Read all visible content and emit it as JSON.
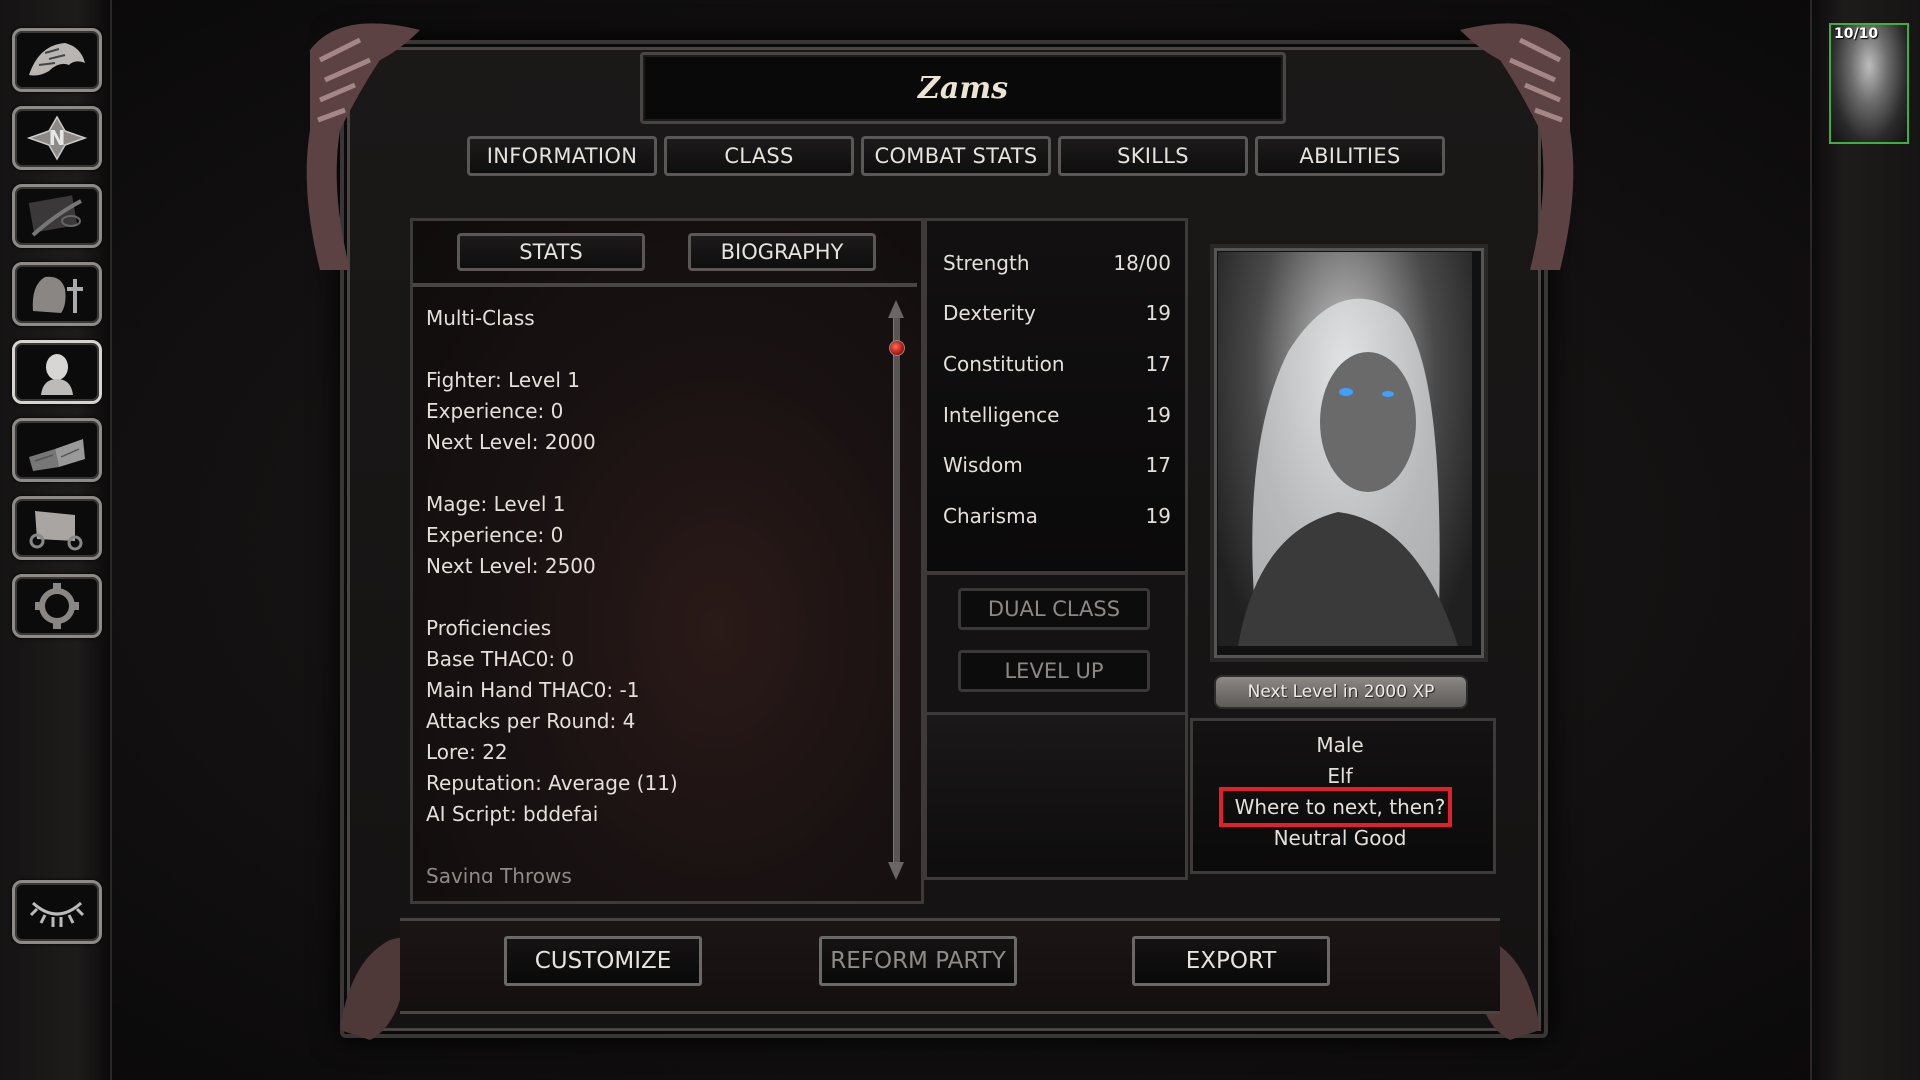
{
  "sidebar": {
    "items": [
      {
        "name": "return-to-game",
        "icon": "dragon-head-icon"
      },
      {
        "name": "map",
        "icon": "compass-icon"
      },
      {
        "name": "journal",
        "icon": "quill-icon"
      },
      {
        "name": "inventory",
        "icon": "armor-sword-icon"
      },
      {
        "name": "character-record",
        "icon": "head-bust-icon",
        "active": true
      },
      {
        "name": "mage-spellbook",
        "icon": "book-icon"
      },
      {
        "name": "priest-scroll",
        "icon": "scroll-icon"
      },
      {
        "name": "options",
        "icon": "gear-icon"
      }
    ],
    "rest_button_icon": "closed-eye-icon"
  },
  "party": {
    "portraits": [
      {
        "hp": "10/10",
        "selected": true
      }
    ]
  },
  "character": {
    "name": "Zams"
  },
  "tabs": [
    "INFORMATION",
    "CLASS",
    "COMBAT STATS",
    "SKILLS",
    "ABILITIES"
  ],
  "subtabs": [
    "STATS",
    "BIOGRAPHY"
  ],
  "info_lines": [
    "Multi-Class",
    "",
    "Fighter: Level 1",
    "Experience: 0",
    "Next Level: 2000",
    "",
    "Mage: Level 1",
    "Experience: 0",
    "Next Level: 2500",
    "",
    "Proficiencies",
    "Base THAC0: 0",
    "Main Hand THAC0: -1",
    "Attacks per Round: 4",
    "Lore: 22",
    "Reputation: Average (11)",
    "AI Script: bddefai",
    "",
    "Saving Throws"
  ],
  "scroll_position": 0,
  "abilities": [
    {
      "label": "Strength",
      "value": "18/00"
    },
    {
      "label": "Dexterity",
      "value": "19"
    },
    {
      "label": "Constitution",
      "value": "17"
    },
    {
      "label": "Intelligence",
      "value": "19"
    },
    {
      "label": "Wisdom",
      "value": "17"
    },
    {
      "label": "Charisma",
      "value": "19"
    }
  ],
  "actions": {
    "dual_class": "DUAL CLASS",
    "level_up": "LEVEL UP"
  },
  "xp_bar": "Next Level in 2000 XP",
  "bio": {
    "gender": "Male",
    "race": "Elf",
    "quote": "Where to next, then?",
    "alignment": "Neutral Good"
  },
  "highlight_color": "#e0202a",
  "bottom_buttons": {
    "customize": "CUSTOMIZE",
    "reform_party": "REFORM PARTY",
    "export": "EXPORT"
  }
}
